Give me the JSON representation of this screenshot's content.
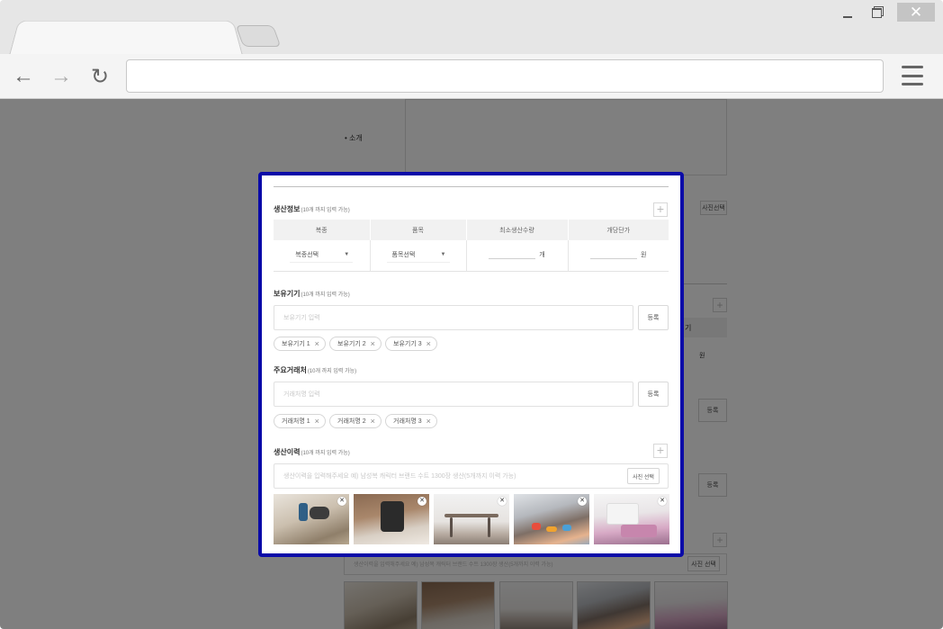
{
  "sections": {
    "intro_label": "• 소개",
    "production": {
      "title": "생산정보",
      "hint": "(10개 까지 입력 가능)",
      "columns": [
        "복종",
        "품목",
        "최소생산수량",
        "개당단가"
      ],
      "select_category": "복종선택",
      "select_item": "품목선택",
      "qty_unit": "개",
      "price_unit": "원"
    },
    "equipment": {
      "title": "보유기기",
      "hint": "(10개 까지 입력 가능)",
      "placeholder": "보유기기 입력",
      "register": "등록",
      "chips": [
        "보유기기 1",
        "보유기기 2",
        "보유기기 3"
      ]
    },
    "clients": {
      "title": "주요거래처",
      "hint": "(10개 까지 입력 가능)",
      "placeholder": "거래처명 입력",
      "register": "등록",
      "chips": [
        "거래처명 1",
        "거래처명 2",
        "거래처명 3"
      ]
    },
    "history": {
      "title": "생산이력",
      "hint": "(10개 까지 입력 가능)",
      "placeholder": "생산이력을 입력해주세요 예) 남성복 캐릭터 브랜드 수트 1300장 생산(5개까지 이력 가능)",
      "photo_button": "사진 선택",
      "photo_count": 5
    }
  },
  "background": {
    "photo_button": "사진선택",
    "register": "등록",
    "price_unit": "원",
    "partial_label": "기",
    "history_placeholder": "생산이력을 입력해주세요 예) 남성복 캐릭터 브랜드 수트 1300장 생산(5개까지 이력 가능)",
    "photo_button2": "사진 선택"
  },
  "colors": {
    "modal_border": "#0a0aa8",
    "overlay": "rgba(0,0,0,0.5)"
  },
  "icons": {
    "back": "←",
    "forward": "→",
    "reload": "↻",
    "close": "✕",
    "remove": "×",
    "plus": "+",
    "caret": "▼"
  }
}
